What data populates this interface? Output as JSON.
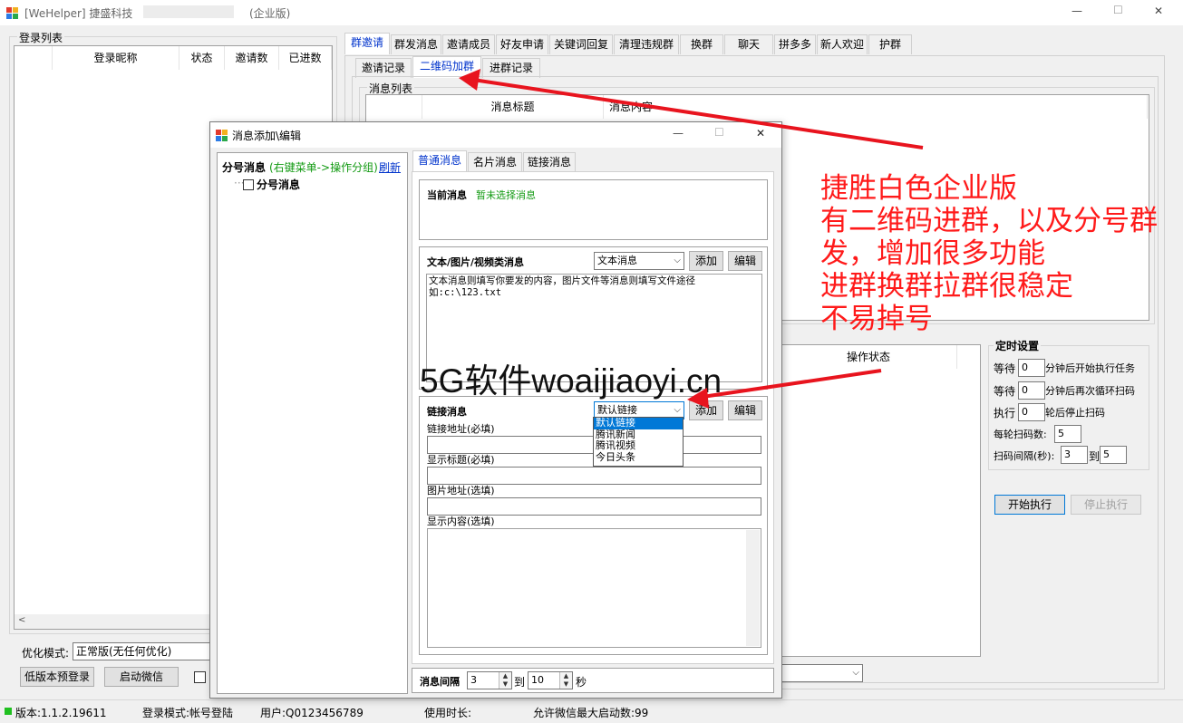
{
  "window": {
    "title_prefix": "[WeHelper] 捷盛科技",
    "title_suffix": "(企业版)",
    "minimize": "—",
    "maximize": "☐",
    "close": "✕"
  },
  "login_list": {
    "group_label": "登录列表",
    "columns": [
      "登录昵称",
      "状态",
      "邀请数",
      "已进数"
    ]
  },
  "main_tabs": [
    "群邀请",
    "群发消息",
    "邀请成员",
    "好友申请",
    "关键词回复",
    "清理违规群",
    "换群",
    "聊天",
    "拼多多",
    "新人欢迎",
    "护群"
  ],
  "sub_tabs": [
    "邀请记录",
    "二维码加群",
    "进群记录"
  ],
  "message_list": {
    "group_label": "消息列表",
    "columns": [
      "消息标题",
      "消息内容"
    ]
  },
  "op_status_header": "操作状态",
  "schedule": {
    "title": "定时设置",
    "wait_label": "等待",
    "wait_value": "0",
    "wait_suffix": "分钟后开始执行任务",
    "wait2_label": "等待",
    "wait2_value": "0",
    "wait2_suffix": "分钟后再次循环扫码",
    "exec_label": "执行",
    "exec_value": "0",
    "exec_suffix": "轮后停止扫码",
    "per_round_label": "每轮扫码数:",
    "per_round_value": "5",
    "interval_label": "扫码间隔(秒):",
    "interval_from": "3",
    "interval_to_label": "到",
    "interval_to": "5",
    "start_button": "开始执行",
    "stop_button": "停止执行"
  },
  "bottom_left": {
    "optimize_label": "优化模式:",
    "optimize_value": "正常版(无任何优化)",
    "low_version_button": "低版本预登录",
    "start_wechat_button": "启动微信"
  },
  "status_bar": {
    "version": "版本:1.1.2.19611",
    "login_mode": "登录模式:帐号登陆",
    "user": "用户:Q0123456789",
    "duration": "使用时长:",
    "max_start": "允许微信最大启动数:99"
  },
  "dialog": {
    "title": "消息添加\\编辑",
    "tree_header": "分号消息",
    "tree_hint": "(右键菜单->操作分组)",
    "tree_refresh": "刷新",
    "tree_item": "分号消息",
    "tabs": [
      "普通消息",
      "名片消息",
      "链接消息"
    ],
    "current_label": "当前消息",
    "current_value": "暂未选择消息",
    "text_section_label": "文本/图片/视频类消息",
    "text_type_value": "文本消息",
    "add_button": "添加",
    "edit_button": "编辑",
    "text_placeholder": "文本消息则填写你要发的内容，图片文件等消息则填写文件途径如:c:\\123.txt",
    "link_section_label": "链接消息",
    "link_type_value": "默认链接",
    "link_options": [
      "默认链接",
      "腾讯新闻",
      "腾讯视频",
      "今日头条"
    ],
    "link_add_button": "添加",
    "link_edit_button": "编辑",
    "link_url_label": "链接地址(必填)",
    "link_title_label": "显示标题(必填)",
    "link_image_label": "图片地址(选填)",
    "link_content_label": "显示内容(选填)",
    "interval_label": "消息间隔",
    "interval_from": "3",
    "interval_to_label": "到",
    "interval_to": "10",
    "interval_unit": "秒"
  },
  "annotation": {
    "lines": [
      "捷胜白色企业版",
      "有二维码进群，以及分号群",
      "发，增加很多功能",
      "进群换群拉群很稳定",
      "不易掉号"
    ],
    "watermark": "5G软件woaijiaoyi.cn"
  },
  "colors": {
    "annotation_red": "#ff1a1a",
    "active_tab_blue": "#0033cc",
    "hint_green": "#129a12",
    "selection_blue": "#0078d7"
  }
}
